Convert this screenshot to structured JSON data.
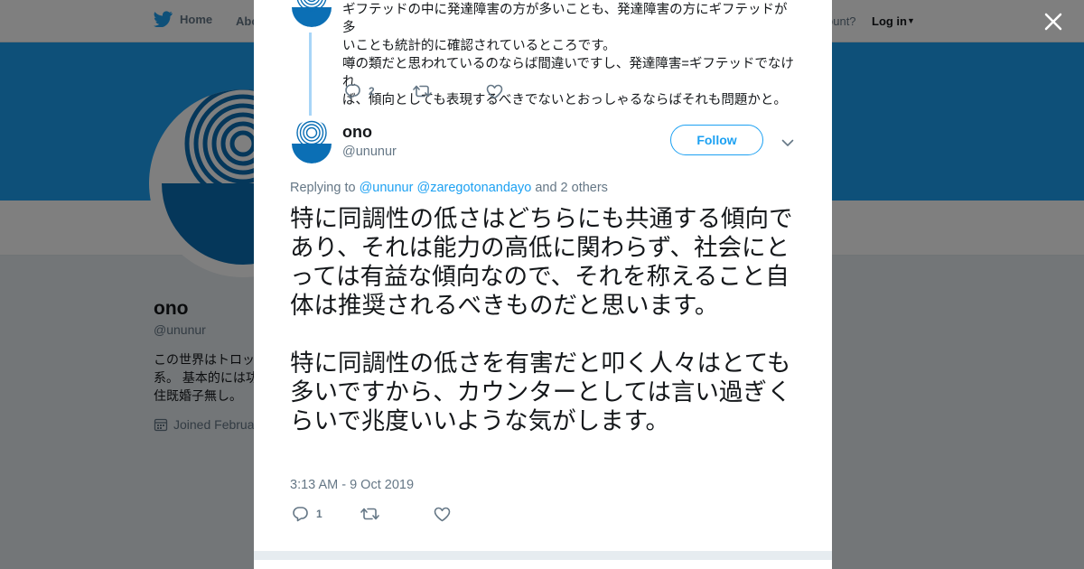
{
  "nav": {
    "home_label": "Home",
    "about_label": "Abo",
    "account_text": "ccount?",
    "login_label": "Log in"
  },
  "profile": {
    "name": "ono",
    "handle": "@ununur",
    "bio_line1": "この世界はトロッ",
    "bio_line2": "系。 基本的には功",
    "bio_line3": "住既婚子無し。",
    "joined": "Joined Februa"
  },
  "prev_tweet": {
    "lines": [
      "ギフテッドの中に発達障害の方が多いことも、発達障害の方にギフテッドが多",
      "いことも統計的に確認されているところです。",
      "噂の類だと思われているのならば間違いですし、発達障害=ギフテッドでなけれ",
      "ば、傾向としても表現するべきでないとおっしゃるならばそれも問題かと。"
    ],
    "reply_count": "2"
  },
  "tweet": {
    "author_name": "ono",
    "author_handle": "@ununur",
    "follow_label": "Follow",
    "replying_prefix": "Replying to",
    "replying_user1": "@ununur",
    "replying_user2": "@zaregotonandayo",
    "replying_suffix": "and 2 others",
    "paragraph1": "特に同調性の低さはどちらにも共通する傾向であり、それは能力の高低に関わらず、社会にとっては有益な傾向なので、それを称えること自体は推奨されるべきものだと思います。",
    "paragraph2": "特に同調性の低さを有害だと叩く人々はとても多いですから、カウンターとしては言い過ぎくらいで兆度いいような気がします。",
    "timestamp": "3:13 AM - 9 Oct 2019",
    "reply_count": "1"
  },
  "colors": {
    "accent": "#1da1f2",
    "banner": "#1da1f2",
    "muted": "#657786",
    "thread_line": "#a8d5f7"
  },
  "icons": [
    "twitter-bird-icon",
    "calendar-icon",
    "close-icon",
    "reply-icon",
    "retweet-icon",
    "like-icon",
    "chevron-down-icon"
  ]
}
